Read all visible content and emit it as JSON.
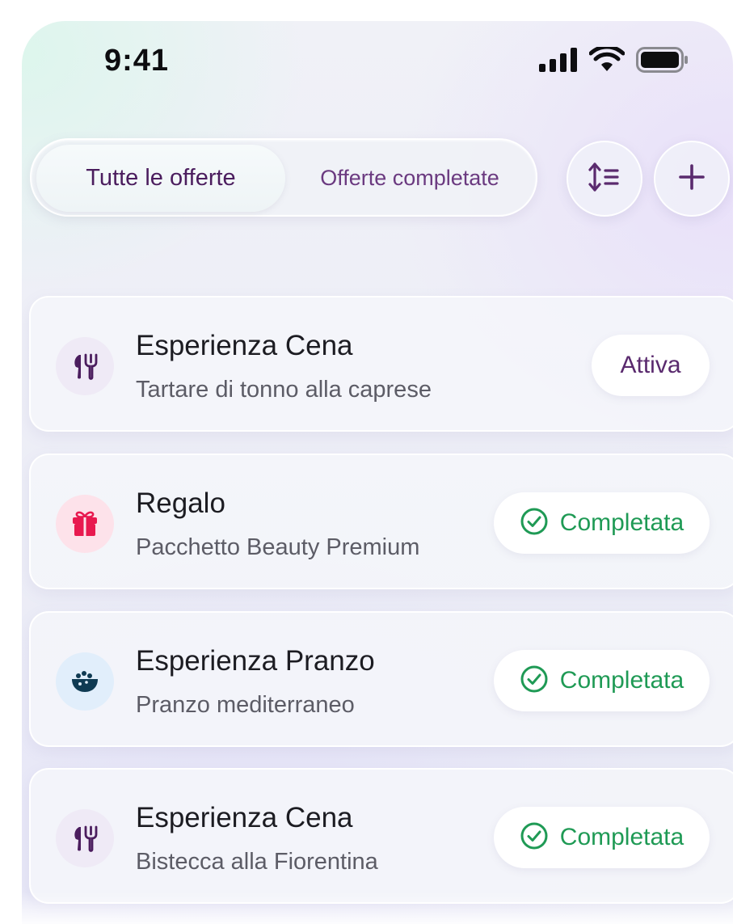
{
  "status_bar": {
    "time": "9:41",
    "icons": [
      "signal-icon",
      "wifi-icon",
      "battery-icon"
    ]
  },
  "tabs": {
    "all_label": "Tutte le offerte",
    "completed_label": "Offerte completate",
    "selected": "all"
  },
  "toolbar": {
    "sort_icon": "sort-icon",
    "add_icon": "plus-icon"
  },
  "colors": {
    "accent_purple": "#5a2a6e",
    "success_green": "#1f9a55",
    "gift_pink": "#e8194f",
    "lunch_navy": "#0f3a52"
  },
  "offers": [
    {
      "title": "Esperienza Cena",
      "subtitle": "Tartare di tonno alla caprese",
      "icon": "fork-knife-icon",
      "status": "Attiva"
    },
    {
      "title": "Regalo",
      "subtitle": "Pacchetto Beauty Premium",
      "icon": "gift-icon",
      "status": "Completata"
    },
    {
      "title": "Esperienza Pranzo",
      "subtitle": "Pranzo mediterraneo",
      "icon": "bowl-icon",
      "status": "Completata"
    },
    {
      "title": "Esperienza Cena",
      "subtitle": "Bistecca alla Fiorentina",
      "icon": "fork-knife-icon",
      "status": "Completata"
    }
  ]
}
